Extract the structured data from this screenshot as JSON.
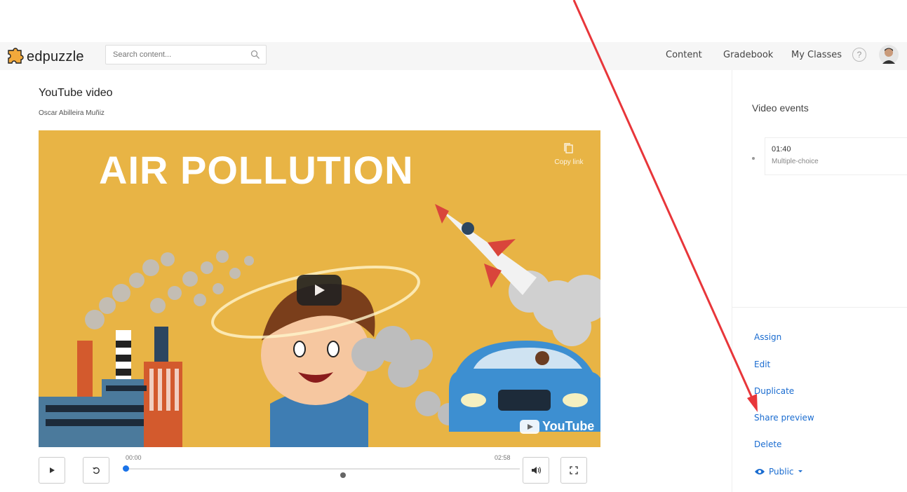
{
  "app": {
    "name": "edpuzzle",
    "brand_color": "#f2a93b"
  },
  "search": {
    "placeholder": "Search content..."
  },
  "nav": {
    "content": "Content",
    "gradebook": "Gradebook",
    "my_classes": "My Classes",
    "help": "?"
  },
  "video_page": {
    "title": "YouTube video",
    "author": "Oscar Abilleira Muñiz"
  },
  "video": {
    "thumbnail_title": "AIR POLLUTION",
    "copy_link": "Copy link",
    "youtube_label": "YouTube"
  },
  "player": {
    "current_time": "00:00",
    "duration": "02:58",
    "progress": 0.0
  },
  "events": {
    "title": "Video events",
    "items": [
      {
        "time": "01:40",
        "type": "Multiple-choice"
      }
    ]
  },
  "actions": {
    "assign": "Assign",
    "edit": "Edit",
    "duplicate": "Duplicate",
    "share_preview": "Share preview",
    "delete": "Delete",
    "visibility": "Public"
  },
  "colors": {
    "link_blue": "#1a6cd0",
    "video_bg": "#e8b445",
    "annotation_arrow": "#e8363a"
  }
}
